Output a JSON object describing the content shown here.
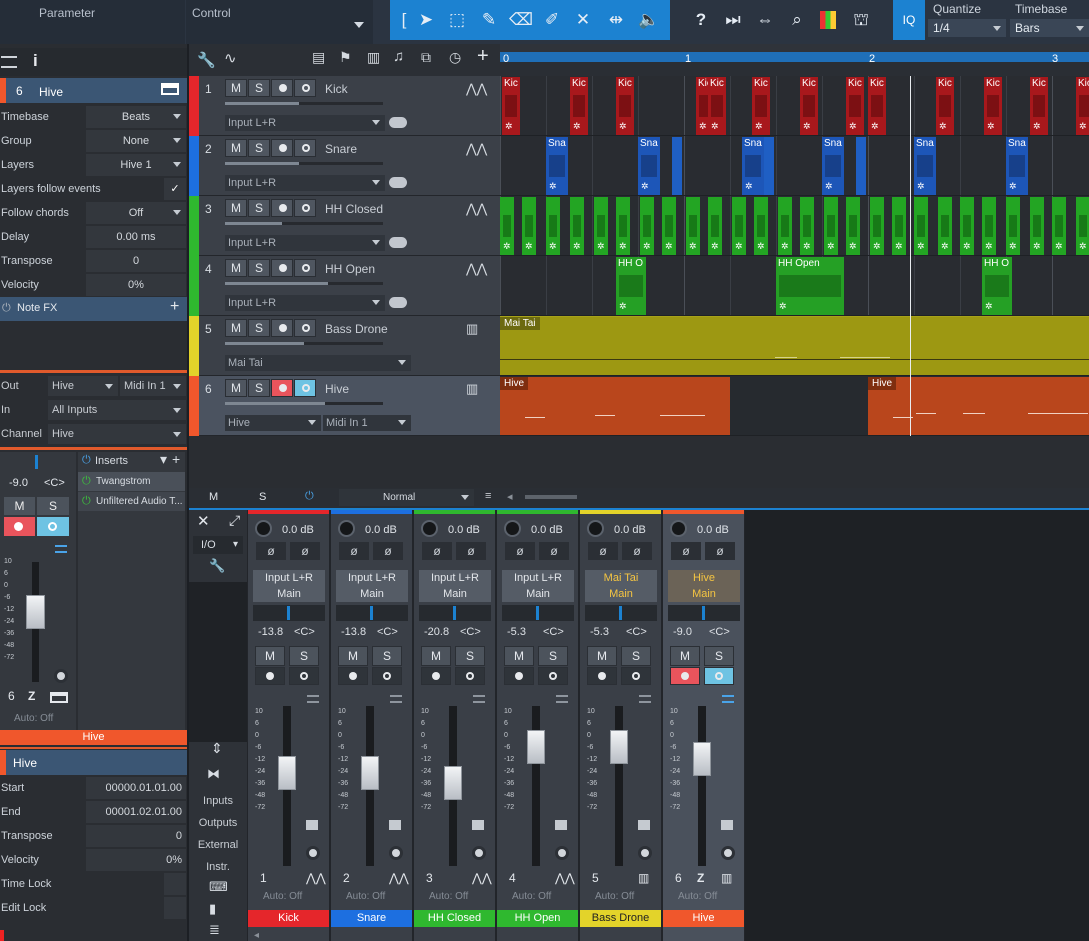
{
  "toolbar": {
    "parameter_label": "Parameter",
    "control_label": "Control",
    "quantize_label": "Quantize",
    "quantize_value": "1/4",
    "timebase_label": "Timebase",
    "timebase_value": "Bars",
    "iq_label": "IQ",
    "help_label": "?"
  },
  "inspector": {
    "track_number": "6",
    "track_name": "Hive",
    "rows": [
      {
        "label": "Timebase",
        "value": "Beats"
      },
      {
        "label": "Group",
        "value": "None"
      },
      {
        "label": "Layers",
        "value": "Hive 1"
      },
      {
        "label": "Layers follow events",
        "value": "✓"
      },
      {
        "label": "Follow chords",
        "value": "Off"
      },
      {
        "label": "Delay",
        "value": "0.00 ms"
      },
      {
        "label": "Transpose",
        "value": "0"
      },
      {
        "label": "Velocity",
        "value": "0%"
      }
    ],
    "notefx_label": "Note FX",
    "routing": {
      "out_label": "Out",
      "out_value": "Hive",
      "out_port": "Midi In 1",
      "in_label": "In",
      "in_value": "All Inputs",
      "channel_label": "Channel",
      "channel_value": "Hive"
    },
    "channel": {
      "pan_value": "-9.0",
      "pan_center": "<C>",
      "m_label": "M",
      "s_label": "S",
      "inserts_label": "Inserts",
      "inserts": [
        "Twangstrom",
        "Unfiltered Audio T..."
      ],
      "fader_scale": [
        "10",
        "6",
        "0",
        "-6",
        "-12",
        "-24",
        "-36",
        "-48",
        "-72"
      ],
      "number": "6",
      "auto_label": "Auto: Off",
      "name": "Hive"
    },
    "event": {
      "name": "Hive",
      "rows": [
        {
          "label": "Start",
          "value": "00000.01.01.00"
        },
        {
          "label": "End",
          "value": "00001.02.01.00"
        },
        {
          "label": "Transpose",
          "value": "0"
        },
        {
          "label": "Velocity",
          "value": "0%"
        },
        {
          "label": "Time Lock",
          "value": ""
        },
        {
          "label": "Edit Lock",
          "value": ""
        }
      ]
    }
  },
  "tracks": [
    {
      "num": "1",
      "name": "Kick",
      "input": "Input L+R",
      "color": "#e5262b",
      "fader": 0.47,
      "type": "audio"
    },
    {
      "num": "2",
      "name": "Snare",
      "input": "Input L+R",
      "color": "#1d6fe0",
      "fader": 0.47,
      "type": "audio"
    },
    {
      "num": "3",
      "name": "HH Closed",
      "input": "Input L+R",
      "color": "#2fb82f",
      "fader": 0.36,
      "type": "audio"
    },
    {
      "num": "4",
      "name": "HH Open",
      "input": "Input L+R",
      "color": "#2fb82f",
      "fader": 0.65,
      "type": "audio"
    },
    {
      "num": "5",
      "name": "Bass Drone",
      "input": "Mai Tai",
      "color": "#e3d32a",
      "fader": 0.5,
      "type": "instrument"
    },
    {
      "num": "6",
      "name": "Hive",
      "input": "Hive",
      "input2": "Midi In 1",
      "color": "#f0572c",
      "fader": 0.63,
      "type": "instrument"
    }
  ],
  "track_buttons": {
    "m": "M",
    "s": "S"
  },
  "ruler": {
    "bars": [
      "1",
      "2",
      "3"
    ]
  },
  "clips": {
    "kick_label": "Kic",
    "snare_label": "Sna",
    "hhopen_label": "HH O",
    "hhopen_long_label": "HH Open",
    "maitai_label": "Mai Tai",
    "hive_label": "Hive"
  },
  "mixer_bar": {
    "m": "M",
    "s": "S",
    "mode": "Normal"
  },
  "mixer": {
    "side_buttons": [
      "Inputs",
      "Outputs",
      "External",
      "Instr."
    ],
    "io_label": "I/O",
    "strips": [
      {
        "db": "0.0 dB",
        "route1": "Input L+R",
        "route2": "Main",
        "pan": "-13.8",
        "panc": "<C>",
        "num": "1",
        "auto": "Auto: Off",
        "name": "Kick",
        "color": "#e5262b",
        "fader_db": -7,
        "accent": false
      },
      {
        "db": "0.0 dB",
        "route1": "Input L+R",
        "route2": "Main",
        "pan": "-13.8",
        "panc": "<C>",
        "num": "2",
        "auto": "Auto: Off",
        "name": "Snare",
        "color": "#1d6fe0",
        "fader_db": -7,
        "accent": false
      },
      {
        "db": "0.0 dB",
        "route1": "Input L+R",
        "route2": "Main",
        "pan": "-20.8",
        "panc": "<C>",
        "num": "3",
        "auto": "Auto: Off",
        "name": "HH Closed",
        "color": "#2fb82f",
        "fader_db": -12,
        "accent": false
      },
      {
        "db": "0.0 dB",
        "route1": "Input L+R",
        "route2": "Main",
        "pan": "-5.3",
        "panc": "<C>",
        "num": "4",
        "auto": "Auto: Off",
        "name": "HH Open",
        "color": "#2fb82f",
        "fader_db": 0,
        "accent": false
      },
      {
        "db": "0.0 dB",
        "route1": "Mai Tai",
        "route2": "Main",
        "pan": "-5.3",
        "panc": "<C>",
        "num": "5",
        "auto": "Auto: Off",
        "name": "Bass Drone",
        "color": "#e3d32a",
        "fader_db": 0,
        "accent": true
      },
      {
        "db": "0.0 dB",
        "route1": "Hive",
        "route2": "Main",
        "pan": "-9.0",
        "panc": "<C>",
        "num": "6",
        "auto": "Auto: Off",
        "name": "Hive",
        "color": "#f0572c",
        "fader_db": -3,
        "accent": true,
        "selected": true
      }
    ],
    "scale": [
      "10",
      "6",
      "0",
      "-6",
      "-12",
      "-24",
      "-36",
      "-48",
      "-72"
    ],
    "m": "M",
    "s": "S"
  }
}
